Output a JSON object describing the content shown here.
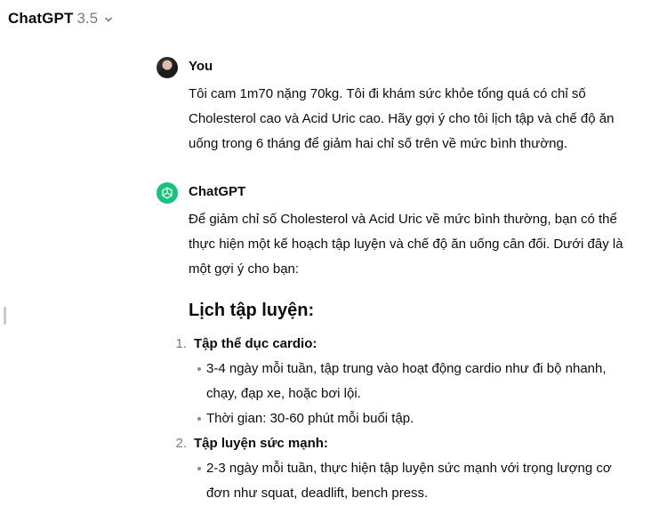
{
  "header": {
    "title": "ChatGPT",
    "version": "3.5"
  },
  "conversation": {
    "user": {
      "author": "You",
      "message": "Tôi cam 1m70 nặng 70kg. Tôi đi khám sức khỏe tổng quá có chỉ số Cholesterol cao và Acid Uric cao. Hãy gợi ý cho tôi lịch tập và chế độ ăn uống trong 6 tháng để giảm hai chỉ số trên về mức bình thường."
    },
    "assistant": {
      "author": "ChatGPT",
      "intro": "Để giảm chỉ số Cholesterol và Acid Uric về mức bình thường, bạn có thể thực hiện một kế hoạch tập luyện và chế độ ăn uống cân đối. Dưới đây là một gợi ý cho bạn:",
      "heading": "Lịch tập luyện:",
      "sections": [
        {
          "number": "1.",
          "title": "Tập thể dục cardio:",
          "bullets": [
            "3-4 ngày mỗi tuần, tập trung vào hoạt động cardio như đi bộ nhanh, chạy, đạp xe, hoặc bơi lội.",
            "Thời gian: 30-60 phút mỗi buổi tập."
          ]
        },
        {
          "number": "2.",
          "title": "Tập luyện sức mạnh:",
          "bullets": [
            "2-3 ngày mỗi tuần, thực hiện tập luyện sức mạnh với trọng lượng cơ đơn như squat, deadlift, bench press."
          ]
        }
      ]
    }
  }
}
